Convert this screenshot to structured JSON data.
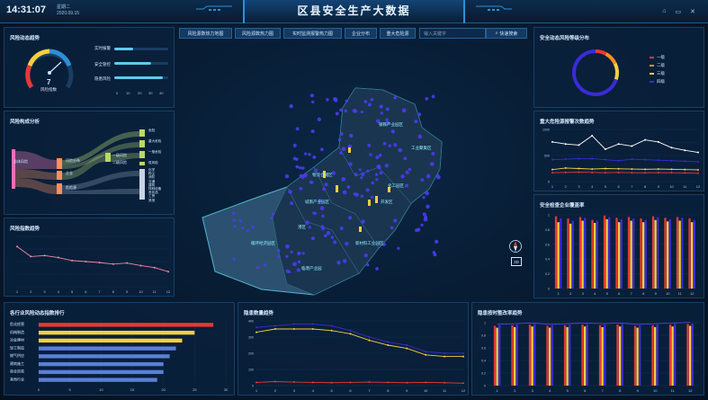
{
  "header": {
    "time": "14:31:07",
    "weekday": "星期二",
    "date": "2020.09.15",
    "title": "区县安全生产大数据",
    "icons": [
      "home-icon",
      "close-panel-icon",
      "close-icon"
    ]
  },
  "tabs": [
    {
      "label": "风险源数热力地图"
    },
    {
      "label": "风险源数热力图"
    },
    {
      "label": "实时监测报警热力图"
    },
    {
      "label": "企业分布"
    },
    {
      "label": "重大危险源"
    }
  ],
  "search": {
    "placeholder": "输入关键字",
    "button": "快速搜索"
  },
  "risk_status": {
    "title": "风险动态趋势",
    "gauge_value": "7",
    "gauge_label": "风险指数",
    "bars": [
      {
        "label": "实时报警",
        "value": 0.35
      },
      {
        "label": "安全管控",
        "value": 0.68
      },
      {
        "label": "隐患风险",
        "value": 0.9
      }
    ],
    "axis": [
      "0",
      "10",
      "20",
      "30",
      "40"
    ]
  },
  "risk_structure": {
    "title": "风险构成分析",
    "source": "总体风险",
    "mid": [
      "风险分布",
      "企业",
      "危险源"
    ],
    "right_a": [
      "一级风险",
      "二级风险"
    ],
    "right": [
      "危险",
      "重大危险",
      "一般危险",
      "低风险",
      "化学",
      "粉尘",
      "消防",
      "交通",
      "建筑",
      "特种设备",
      "危化品",
      "工贸",
      "其他"
    ]
  },
  "risk_index_trend": {
    "title": "风险指数趋势",
    "chart_data": {
      "type": "line",
      "x": [
        "1",
        "2",
        "3",
        "4",
        "5",
        "6",
        "7",
        "8",
        "9",
        "10",
        "11",
        "12"
      ],
      "series": [
        {
          "values": [
            80,
            60,
            62,
            58,
            52,
            50,
            48,
            45,
            47,
            42,
            38,
            30
          ]
        }
      ],
      "ylim": [
        0,
        100
      ]
    }
  },
  "map": {
    "labels": [
      "钢铁产业园区",
      "工业聚集区",
      "物流仓储区",
      "化工园区",
      "开发区",
      "新材料工业园区",
      "循环经济园区",
      "港区",
      "城南产业园区",
      "临港产业园"
    ],
    "compass": "3D"
  },
  "risk_level_dist": {
    "title": "安全动态风险等级分布",
    "legend": [
      {
        "label": "一级",
        "color": "#e53935"
      },
      {
        "label": "二级",
        "color": "#ff8f1f"
      },
      {
        "label": "三级",
        "color": "#f4d03f"
      },
      {
        "label": "四级",
        "color": "#3a2bd6"
      }
    ],
    "chart_data": {
      "type": "pie",
      "categories": [
        "一级",
        "二级",
        "三级",
        "四级"
      ],
      "values": [
        8,
        10,
        12,
        70
      ]
    }
  },
  "major_hazard_trend": {
    "title": "重大危险源报警次数趋势",
    "chart_data": {
      "type": "line",
      "x": [
        "1",
        "2",
        "3",
        "4",
        "5",
        "6",
        "7",
        "8",
        "9",
        "10",
        "11",
        "12"
      ],
      "ylim": [
        0,
        1000
      ],
      "series": [
        {
          "color": "#ffffff",
          "values": [
            760,
            720,
            700,
            880,
            620,
            720,
            680,
            800,
            760,
            650,
            600,
            560
          ]
        },
        {
          "color": "#3a2bd6",
          "values": [
            420,
            430,
            440,
            440,
            420,
            400,
            430,
            420,
            410,
            400,
            390,
            380
          ]
        },
        {
          "color": "#f4d03f",
          "values": [
            230,
            260,
            250,
            240,
            250,
            245,
            240,
            235,
            240,
            235,
            230,
            225
          ]
        },
        {
          "color": "#e53935",
          "values": [
            170,
            175,
            180,
            175,
            170,
            175,
            170,
            168,
            172,
            170,
            165,
            160
          ]
        }
      ]
    }
  },
  "compliance_rate": {
    "title": "安全检查企业覆盖率",
    "chart_data": {
      "type": "bar",
      "categories": [
        "1",
        "2",
        "3",
        "4",
        "5",
        "6",
        "7",
        "8",
        "9",
        "10",
        "11",
        "12"
      ],
      "ylim": [
        0,
        1
      ],
      "series": [
        {
          "color": "#e53935",
          "values": [
            0.98,
            0.95,
            0.97,
            0.93,
            0.99,
            0.96,
            0.97,
            0.95,
            0.98,
            0.96,
            0.97,
            0.95
          ]
        },
        {
          "color": "#f4d03f",
          "values": [
            0.9,
            0.88,
            0.92,
            0.89,
            0.94,
            0.9,
            0.92,
            0.9,
            0.93,
            0.91,
            0.92,
            0.9
          ]
        },
        {
          "color": "#3a2bd6",
          "values": [
            0.95,
            0.92,
            0.96,
            0.92,
            0.97,
            0.94,
            0.95,
            0.93,
            0.97,
            0.94,
            0.96,
            0.93
          ]
        }
      ]
    }
  },
  "industry_rank": {
    "title": "各行业风险动态指数排行",
    "chart_data": {
      "type": "bar",
      "categories": [
        "危化经营",
        "机械制造",
        "冶金建材",
        "轻工制造",
        "燃气供应",
        "建筑施工",
        "商业贸易",
        "其他行业"
      ],
      "values": [
        28,
        25,
        23,
        22,
        21,
        20,
        20,
        19
      ],
      "xlim": [
        0,
        30
      ]
    },
    "axis": [
      "0",
      "5",
      "10",
      "15",
      "20",
      "25",
      "30"
    ]
  },
  "hidden_danger_trend": {
    "title": "隐患数量趋势",
    "chart_data": {
      "type": "line",
      "x": [
        "1",
        "2",
        "3",
        "4",
        "5",
        "6",
        "7",
        "8",
        "9",
        "10",
        "11",
        "12"
      ],
      "ylim": [
        0,
        400
      ],
      "series": [
        {
          "color": "#3a2bd6",
          "values": [
            360,
            370,
            380,
            380,
            370,
            340,
            300,
            270,
            250,
            210,
            200,
            200
          ]
        },
        {
          "color": "#f4d03f",
          "values": [
            330,
            350,
            350,
            350,
            340,
            320,
            280,
            250,
            230,
            190,
            180,
            180
          ]
        },
        {
          "color": "#e53935",
          "values": [
            20,
            25,
            22,
            20,
            18,
            20,
            22,
            20,
            18,
            20,
            18,
            15
          ]
        }
      ]
    }
  },
  "rectify_rate": {
    "title": "隐患按时整改率趋势",
    "chart_data": {
      "type": "bar",
      "categories": [
        "1",
        "2",
        "3",
        "4",
        "5",
        "6",
        "7",
        "8",
        "9",
        "10",
        "11",
        "12"
      ],
      "ylim": [
        0,
        1
      ],
      "series": [
        {
          "color": "#e53935",
          "values": [
            0.95,
            0.96,
            0.97,
            0.95,
            0.96,
            0.97,
            0.96,
            0.97,
            0.95,
            0.96,
            0.97,
            0.98
          ]
        },
        {
          "color": "#f4d03f",
          "values": [
            0.92,
            0.93,
            0.94,
            0.92,
            0.93,
            0.94,
            0.93,
            0.94,
            0.92,
            0.93,
            0.94,
            0.95
          ]
        },
        {
          "color": "#3a2bd6",
          "values": [
            0.96,
            0.97,
            0.98,
            0.96,
            0.97,
            0.98,
            0.97,
            0.98,
            0.96,
            0.97,
            0.98,
            0.99
          ]
        }
      ]
    }
  }
}
